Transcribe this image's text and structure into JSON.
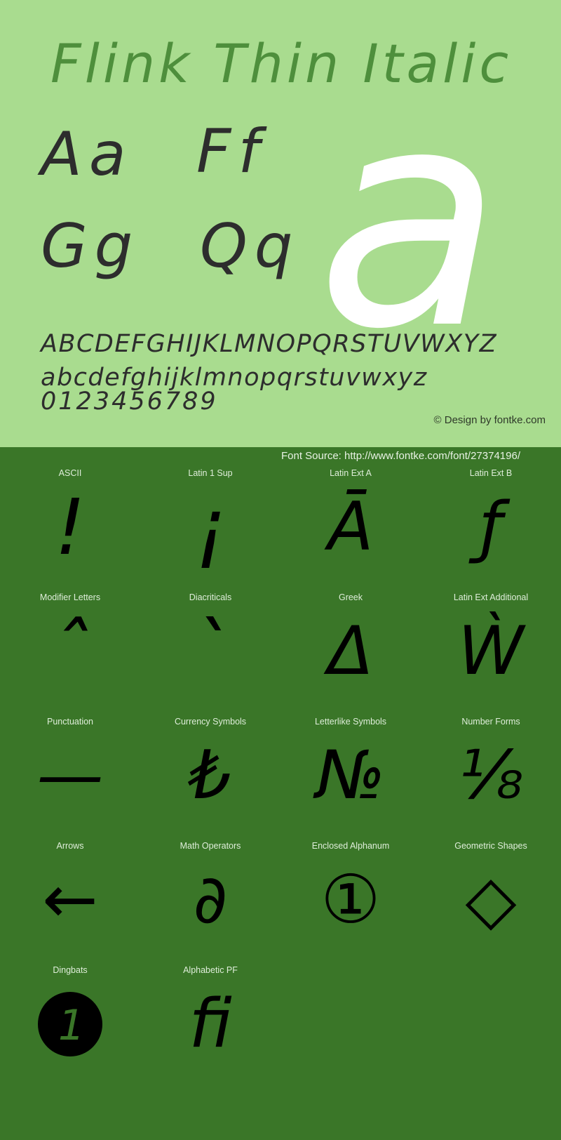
{
  "hero": {
    "title": "Flink Thin Italic",
    "pairs": [
      {
        "name": "aa",
        "text": "Aa"
      },
      {
        "name": "ff",
        "text": "Ff"
      },
      {
        "name": "gg",
        "text": "Gg"
      },
      {
        "name": "qq",
        "text": "Qq"
      }
    ],
    "big_glyph": "a",
    "uppercase": "ABCDEFGHIJKLMNOPQRSTUVWXYZ",
    "lowercase": "abcdefghijklmnopqrstuvwxyz",
    "digits": "0123456789",
    "copyright": "© Design by fontke.com",
    "bg_color": "#a9dc8f",
    "title_color": "#4e8f3c",
    "big_glyph_color": "#ffffff"
  },
  "glyph_panel": {
    "font_source": "Font Source: http://www.fontke.com/font/27374196/",
    "bg_color": "#3a7628",
    "label_color": "#dfeeda",
    "glyph_color": "#000000",
    "cells": [
      {
        "label": "ASCII",
        "glyph": "!",
        "size": "dot"
      },
      {
        "label": "Latin 1 Sup",
        "glyph": "¡",
        "size": "dot"
      },
      {
        "label": "Latin Ext A",
        "glyph": "Ā",
        "size": ""
      },
      {
        "label": "Latin Ext B",
        "glyph": "ƒ",
        "size": ""
      },
      {
        "label": "Modifier Letters",
        "glyph": "ˆ",
        "size": "dot"
      },
      {
        "label": "Diacriticals",
        "glyph": "◌̀",
        "size": "dot"
      },
      {
        "label": "Greek",
        "glyph": "Δ",
        "size": ""
      },
      {
        "label": "Latin Ext Additional",
        "glyph": "Ẁ",
        "size": ""
      },
      {
        "label": "Punctuation",
        "glyph": "—",
        "size": ""
      },
      {
        "label": "Currency Symbols",
        "glyph": "₺",
        "size": ""
      },
      {
        "label": "Letterlike Symbols",
        "glyph": "№",
        "size": ""
      },
      {
        "label": "Number Forms",
        "glyph": "⅛",
        "size": ""
      },
      {
        "label": "Arrows",
        "glyph": "←",
        "size": ""
      },
      {
        "label": "Math Operators",
        "glyph": "∂",
        "size": ""
      },
      {
        "label": "Enclosed Alphanum",
        "glyph": "①",
        "size": ""
      },
      {
        "label": "Geometric Shapes",
        "glyph": "◇",
        "size": ""
      },
      {
        "label": "Dingbats",
        "glyph": "❶",
        "size": ""
      },
      {
        "label": "Alphabetic PF",
        "glyph": "ﬁ",
        "size": ""
      },
      {
        "label": "",
        "glyph": "",
        "size": ""
      },
      {
        "label": "",
        "glyph": "",
        "size": ""
      }
    ]
  }
}
